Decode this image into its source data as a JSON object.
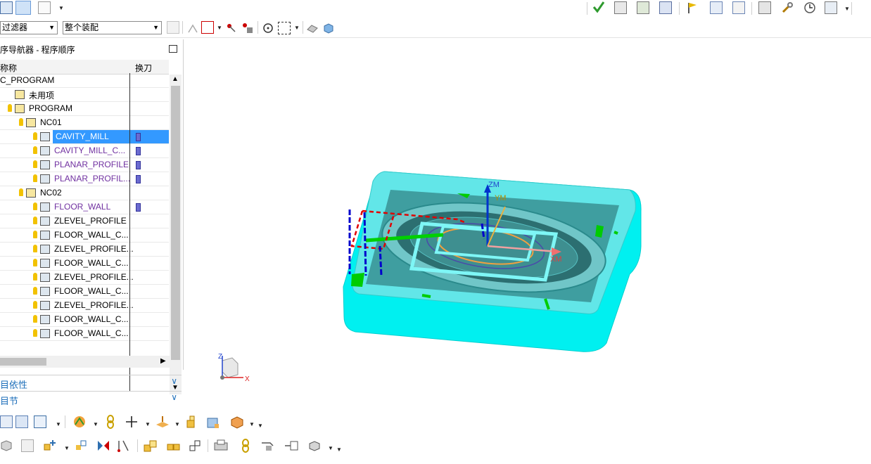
{
  "toolbar": {
    "type_filter_value": "过滤器",
    "assembly_scope_value": "整个装配"
  },
  "navigator": {
    "title": "序导航器 - 程序顺序",
    "columns": {
      "name": "称称",
      "tool_change": "换刀"
    },
    "rows": [
      {
        "label": "C_PROGRAM",
        "color": "black"
      },
      {
        "label": "未用项",
        "color": "black"
      },
      {
        "label": "PROGRAM",
        "color": "black"
      },
      {
        "label": "NC01",
        "color": "black"
      },
      {
        "label": "CAVITY_MILL",
        "color": "purple",
        "selected": true
      },
      {
        "label": "CAVITY_MILL_C...",
        "color": "purple"
      },
      {
        "label": "PLANAR_PROFILE",
        "color": "purple"
      },
      {
        "label": "PLANAR_PROFIL...",
        "color": "purple"
      },
      {
        "label": "NC02",
        "color": "black"
      },
      {
        "label": "FLOOR_WALL",
        "color": "purple"
      },
      {
        "label": "ZLEVEL_PROFILE",
        "color": "black"
      },
      {
        "label": "FLOOR_WALL_C...",
        "color": "black"
      },
      {
        "label": "ZLEVEL_PROFILE...",
        "color": "black"
      },
      {
        "label": "FLOOR_WALL_C...",
        "color": "black"
      },
      {
        "label": "ZLEVEL_PROFILE...",
        "color": "black"
      },
      {
        "label": "FLOOR_WALL_C...",
        "color": "black"
      },
      {
        "label": "ZLEVEL_PROFILE...",
        "color": "black"
      },
      {
        "label": "FLOOR_WALL_C...",
        "color": "black"
      },
      {
        "label": "FLOOR_WALL_C...",
        "color": "black"
      }
    ]
  },
  "panels": {
    "dependencies": "目依性",
    "details": "目节"
  },
  "viewport": {
    "axis_zm": "ZM",
    "axis_ym": "YM",
    "axis_xm": "XM",
    "triad_z": "Z",
    "triad_x": "X"
  },
  "colors": {
    "part_cyan": "#00f0f0",
    "selection_blue": "#3399ff",
    "op_purple": "#7030a0",
    "panel_blue": "#1e6fba"
  }
}
